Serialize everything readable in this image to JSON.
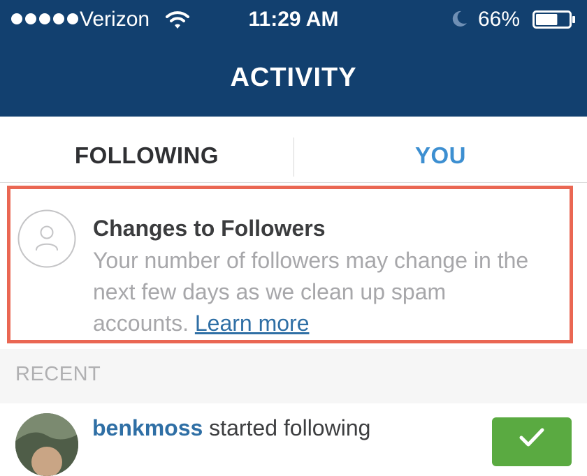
{
  "status_bar": {
    "carrier": "Verizon",
    "time": "11:29 AM",
    "battery_percent": "66%",
    "signal_bars": 5,
    "battery_level": 0.66
  },
  "header": {
    "title": "ACTIVITY"
  },
  "tabs": [
    {
      "label": "FOLLOWING",
      "active": false
    },
    {
      "label": "YOU",
      "active": true
    }
  ],
  "notice": {
    "title": "Changes to Followers",
    "body": "Your number of followers may change in the next few days as we clean up spam accounts.",
    "link_label": "Learn more",
    "border_color": "#ea6753"
  },
  "recent": {
    "heading": "RECENT",
    "items": [
      {
        "username": "benkmoss",
        "action": "started following"
      }
    ]
  },
  "colors": {
    "header_bg": "#12406f",
    "active_tab": "#3d8fd1",
    "link": "#2f6fa5",
    "follow_button": "#5aaa41"
  },
  "icons": [
    "wifi-icon",
    "moon-icon",
    "battery-icon",
    "user-placeholder-icon",
    "checkmark-icon"
  ]
}
